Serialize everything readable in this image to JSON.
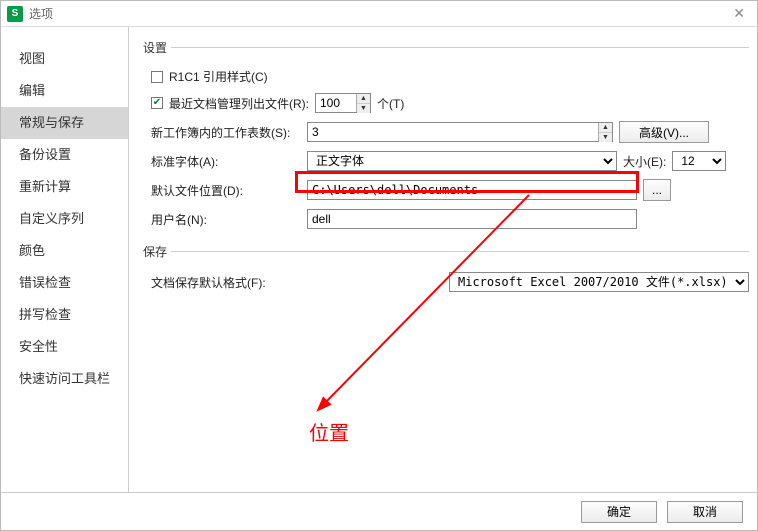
{
  "window": {
    "title": "选项"
  },
  "sidebar": {
    "items": [
      {
        "label": "视图"
      },
      {
        "label": "编辑"
      },
      {
        "label": "常规与保存",
        "selected": true
      },
      {
        "label": "备份设置"
      },
      {
        "label": "重新计算"
      },
      {
        "label": "自定义序列"
      },
      {
        "label": "颜色"
      },
      {
        "label": "错误检查"
      },
      {
        "label": "拼写检查"
      },
      {
        "label": "安全性"
      },
      {
        "label": "快速访问工具栏"
      }
    ]
  },
  "settings": {
    "section_label": "设置",
    "r1c1_label": "R1C1 引用样式(C)",
    "r1c1_checked": false,
    "recent_label": "最近文档管理列出文件(R):",
    "recent_value": "100",
    "recent_suffix": "个(T)",
    "sheets_label": "新工作簿内的工作表数(S):",
    "sheets_value": "3",
    "advanced_btn": "高级(V)...",
    "font_label": "标准字体(A):",
    "font_value": "正文字体",
    "size_label": "大小(E):",
    "size_value": "12",
    "path_label": "默认文件位置(D):",
    "path_value": "C:\\Users\\dell\\Documents",
    "path_browse": "...",
    "user_label": "用户名(N):",
    "user_value": "dell"
  },
  "save": {
    "section_label": "保存",
    "format_label": "文档保存默认格式(F):",
    "format_value": "Microsoft Excel 2007/2010 文件(*.xlsx)"
  },
  "annotation": {
    "label": "位置"
  },
  "footer": {
    "ok": "确定",
    "cancel": "取消"
  }
}
